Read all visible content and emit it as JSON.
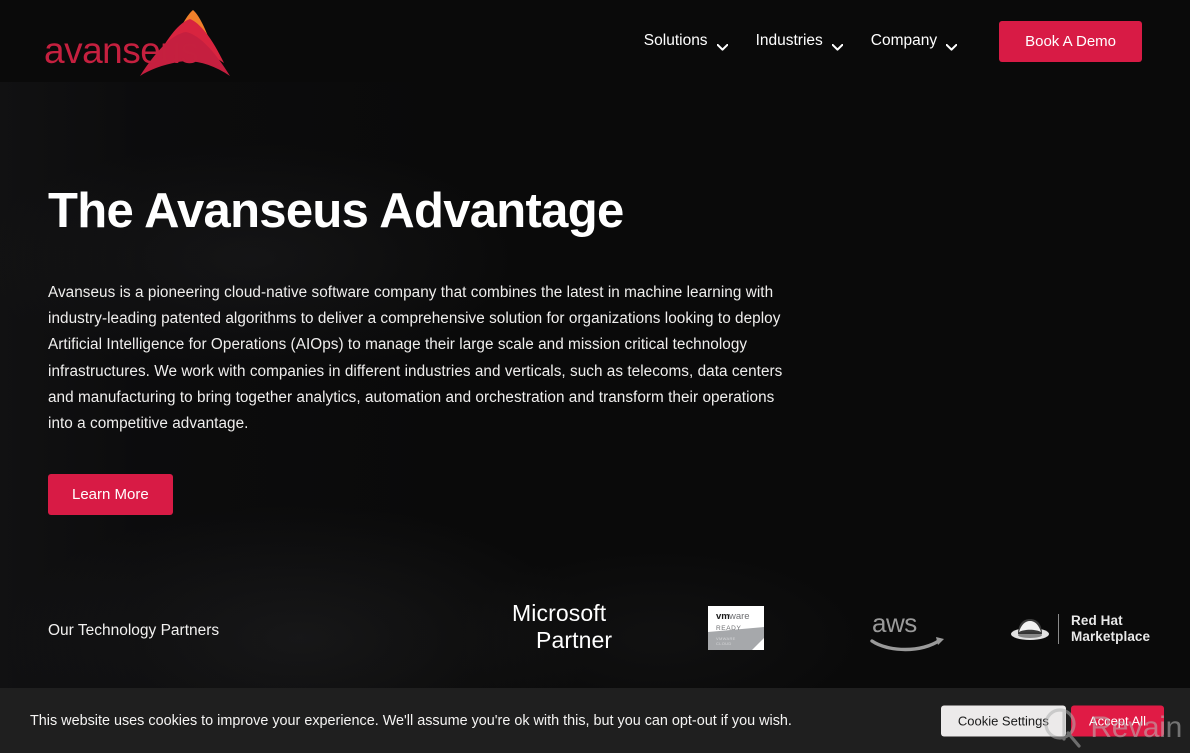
{
  "header": {
    "logo_text": "avanseus",
    "logo_name": "avanseus-logo",
    "nav": [
      {
        "label": "Solutions",
        "icon": "chevron-down-icon"
      },
      {
        "label": "Industries",
        "icon": "chevron-down-icon"
      },
      {
        "label": "Company",
        "icon": "chevron-down-icon"
      }
    ],
    "demo_button": "Book A Demo"
  },
  "hero": {
    "title": "The Avanseus Advantage",
    "paragraph": "Avanseus is a pioneering cloud-native software company that combines the latest in machine learning with industry-leading patented algorithms to deliver a comprehensive solution for organizations looking to deploy Artificial Intelligence for Operations (AIOps) to manage their large scale and mission critical technology infrastructures. We work with companies in different industries and verticals, such as telecoms, data centers and manufacturing to bring together analytics, automation and orchestration and transform their operations into a competitive advantage.",
    "cta_button": "Learn More"
  },
  "partners": {
    "label": "Our Technology Partners",
    "microsoft": {
      "line1": "Microsoft",
      "line2": "Partner",
      "icon": "microsoft-partner-logo"
    },
    "vmware": {
      "brand": "vmware",
      "status": "READY",
      "sub": "VMWARE READY",
      "icon": "vmware-ready-badge"
    },
    "aws": {
      "wordmark": "aws",
      "icon": "aws-logo"
    },
    "redhat": {
      "line1": "Red Hat",
      "line2": "Marketplace",
      "icon": "red-hat-marketplace-logo"
    }
  },
  "cookie_banner": {
    "message": "This website uses cookies to improve your experience. We'll assume you're ok with this, but you can opt-out if you wish.",
    "settings_button": "Cookie Settings",
    "accept_button": "Accept All"
  },
  "watermark": {
    "text": "Revain",
    "icon": "revain-logo"
  },
  "colors": {
    "background": "#0a0a0a",
    "accent_crimson": "#d81b45",
    "accent_orange": "#f08022",
    "text_primary": "#ffffff",
    "cookie_bar": "#1f1f1f"
  }
}
